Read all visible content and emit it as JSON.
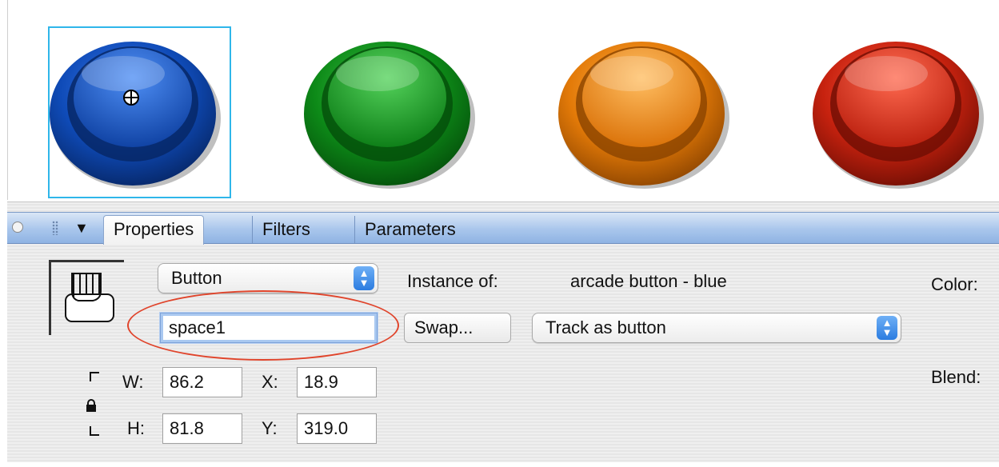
{
  "tabs": {
    "properties": "Properties",
    "filters": "Filters",
    "parameters": "Parameters"
  },
  "symbol": {
    "type_select": "Button",
    "instance_name": "space1",
    "instance_label": "Instance of:",
    "instance_value": "arcade button - blue",
    "swap_label": "Swap...",
    "tracking_select": "Track as button",
    "color_label": "Color:",
    "blend_label": "Blend:"
  },
  "dimensions": {
    "w_label": "W:",
    "w_value": "86.2",
    "h_label": "H:",
    "h_value": "81.8",
    "x_label": "X:",
    "x_value": "18.9",
    "y_label": "Y:",
    "y_value": "319.0"
  },
  "stage": {
    "buttons": [
      {
        "name": "arcade-button-blue",
        "color": "#0b3e9c"
      },
      {
        "name": "arcade-button-green",
        "color": "#0a8a16"
      },
      {
        "name": "arcade-button-orange",
        "color": "#e37a08"
      },
      {
        "name": "arcade-button-red",
        "color": "#c7220f"
      }
    ],
    "selection_color": "#2fb6ea",
    "highlight_color": "#e0442b"
  },
  "icons": [
    "registration-point-icon",
    "collapse-arrow-icon",
    "button-symbol-icon",
    "lock-icon",
    "stepper-arrows-icon"
  ]
}
